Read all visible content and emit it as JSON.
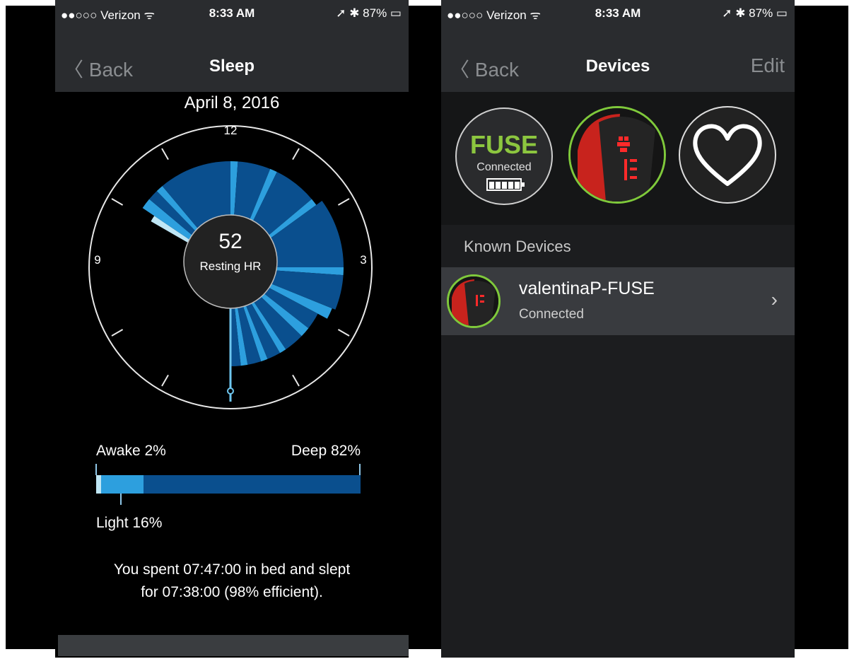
{
  "left": {
    "status": {
      "carrier": "●●○○○ Verizon ᯤ",
      "time": "8:33 AM",
      "right": "➚ ✱ 87% ▭"
    },
    "nav": {
      "back": "〈 Back",
      "title": "Sleep"
    },
    "date": "April 8, 2016",
    "dial": {
      "label_12": "12",
      "label_3": "3",
      "label_9": "9",
      "hr_value": "52",
      "hr_label": "Resting HR"
    },
    "legend": {
      "awake": "Awake 2%",
      "deep": "Deep 82%",
      "light": "Light 16%"
    },
    "breakdown": {
      "awake_pct": 2,
      "light_pct": 16,
      "deep_pct": 82
    },
    "summary_line1": "You spent 07:47:00 in bed and slept",
    "summary_line2": "for 07:38:00 (98% efficient)."
  },
  "right": {
    "status": {
      "carrier": "●●○○○ Verizon ᯤ",
      "time": "8:33 AM",
      "right": "➚ ✱ 87% ▭"
    },
    "nav": {
      "back": "〈 Back",
      "title": "Devices",
      "edit": "Edit"
    },
    "fuse": {
      "title": "FUSE",
      "status": "Connected"
    },
    "section_label": "Known Devices",
    "device": {
      "name": "valentinaP-FUSE",
      "status": "Connected",
      "chevron": "›"
    }
  },
  "colors": {
    "deep": "#0a4f8e",
    "light": "#2d9fde",
    "awake": "#bfe6f5",
    "accent": "#7fc93b"
  }
}
